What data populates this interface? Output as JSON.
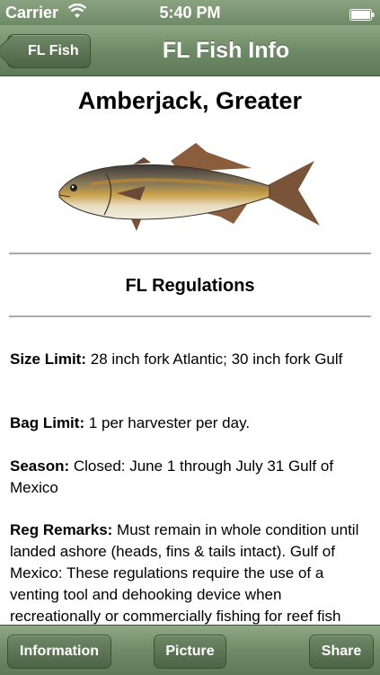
{
  "status_bar": {
    "carrier": "Carrier",
    "time": "5:40 PM",
    "wifi_icon": "wifi-icon",
    "battery_icon": "battery-icon"
  },
  "nav_bar": {
    "back_label": "FL Fish",
    "title": "FL Fish Info"
  },
  "content": {
    "fish_name": "Amberjack, Greater",
    "section_title": "FL Regulations",
    "regulations": [
      {
        "label": "Size Limit:",
        "value": " 28 inch fork Atlantic; 30 inch fork Gulf"
      },
      {
        "label": "Bag Limit:",
        "value": " 1 per harvester per day."
      },
      {
        "label": "Season:",
        "value": " Closed: June 1 through July 31 Gulf of Mexico"
      },
      {
        "label": "Reg Remarks:",
        "value": " Must remain in whole condition until landed ashore (heads, fins & tails intact). Gulf of Mexico: These regulations require the use of a venting tool and dehooking device when recreationally or commercially fishing for reef fish"
      }
    ]
  },
  "toolbar": {
    "information_label": "Information",
    "picture_label": "Picture",
    "share_label": "Share"
  },
  "colors": {
    "bar_green": "#6f8a66",
    "button_green": "#4d6445"
  }
}
